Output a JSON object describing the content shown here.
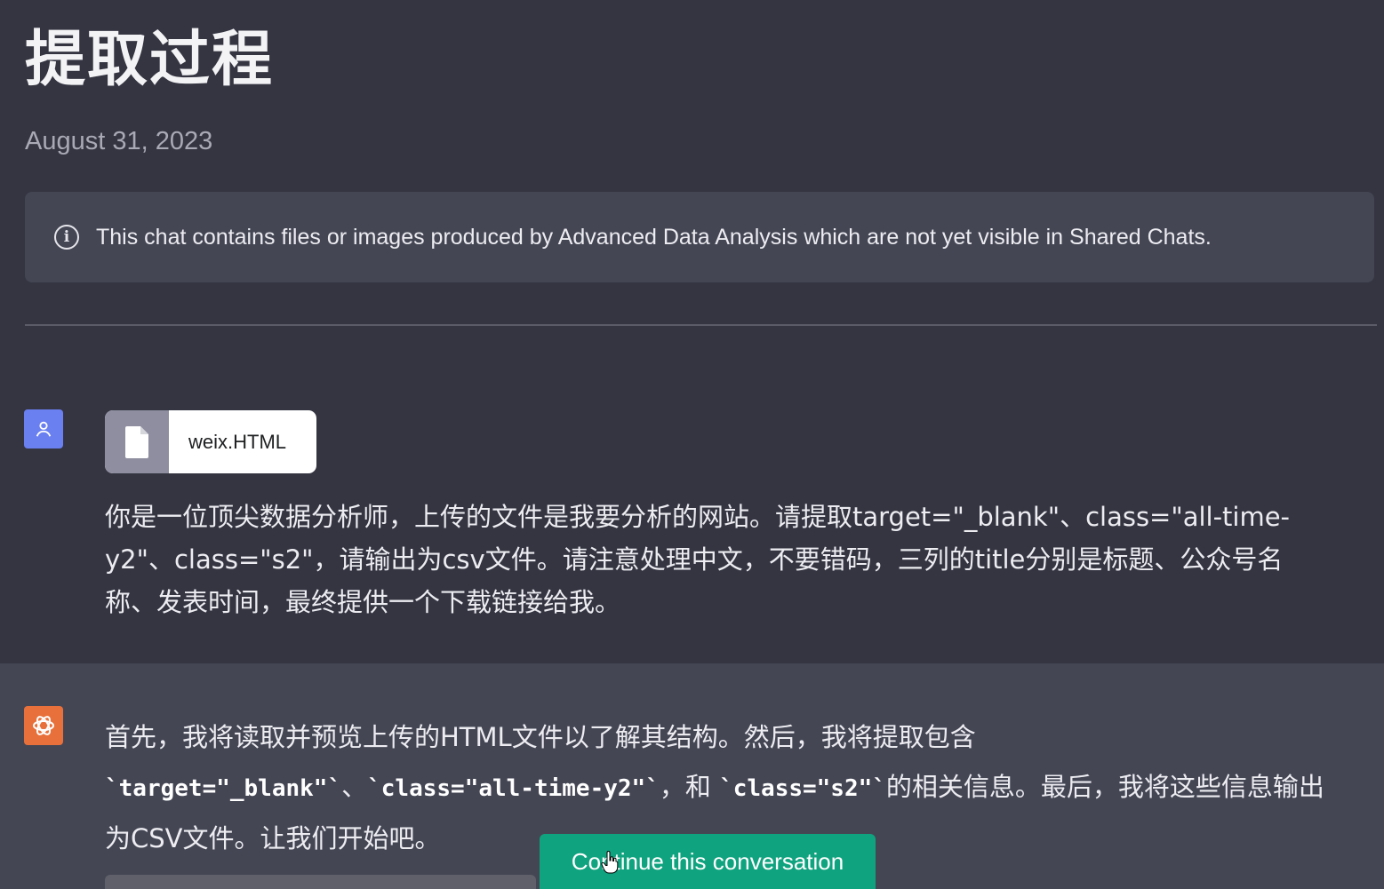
{
  "page": {
    "title": "提取过程",
    "date": "August 31, 2023"
  },
  "notice": {
    "icon": "info-icon",
    "text": "This chat contains files or images produced by Advanced Data Analysis which are not yet visible in Shared Chats."
  },
  "user_message": {
    "avatar_icon": "user-icon",
    "file_name": "weix.HTML",
    "file_icon": "file-icon",
    "text": "你是一位顶尖数据分析师，上传的文件是我要分析的网站。请提取target=\"_blank\"、class=\"all-time-y2\"、class=\"s2\"，请输出为csv文件。请注意处理中文，不要错码，三列的title分别是标题、公众号名称、发表时间，最终提供一个下载链接给我。"
  },
  "assistant_message": {
    "avatar_icon": "openai-logo-icon",
    "part1": "首先，我将读取并预览上传的HTML文件以了解其结构。然后，我将提取包含",
    "code1": "`target=\"_blank\"`",
    "sep1": "、",
    "code2": "`class=\"all-time-y2\"`",
    "sep2": "，和 ",
    "code3": "`class=\"s2\"`",
    "part2": "的相关信息。最后，我将这些信息输出为CSV文件。让我们开始吧。"
  },
  "continue_button": {
    "label": "Continue this conversation"
  },
  "colors": {
    "background": "#343541",
    "panel": "#444654",
    "accent": "#10a37f",
    "user_avatar": "#6a7ff0",
    "assistant_avatar": "#e8703a"
  }
}
